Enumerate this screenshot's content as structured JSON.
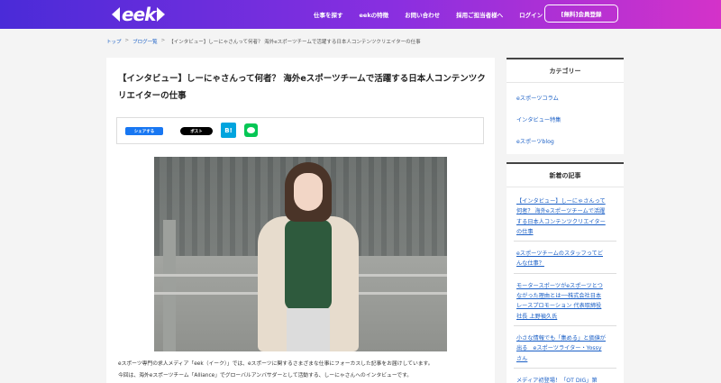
{
  "header": {
    "logo_text": "eek",
    "nav": [
      "仕事を探す",
      "eekの特徴",
      "お問い合わせ",
      "採用ご担当者様へ",
      "ログイン"
    ],
    "register_label": "[無料]会員登録",
    "colors": {
      "gradient_start": "#4a2bd8",
      "gradient_end": "#d432c9"
    }
  },
  "breadcrumb": {
    "items": [
      "トップ",
      "ブログ一覧",
      "【インタビュー】しーにゃさんって何者？ 海外eスポーツチームで活躍する日本人コンテンツクリエイターの仕事"
    ],
    "separator": ">"
  },
  "article": {
    "title": "【インタビュー】しーにゃさんって何者？ 海外eスポーツチームで活躍する日本人コンテンツクリエイターの仕事",
    "share": {
      "facebook_label": "シェアする",
      "x_label": "ポスト",
      "hatena_label": "B!",
      "line_icon": "line-icon"
    },
    "photo_icon": "interview-photo",
    "paragraphs": [
      "eスポーツ専門の求人メディア「eek（イーク）」では、eスポーツに関するさまざまな仕事にフォーカスした記事をお届けしています。",
      "今回は、海外eスポーツチーム「Alliance」でグローバルアンバサダーとして活動する、しーにゃさんへのインタビューです。"
    ]
  },
  "sidebar": {
    "categories": {
      "heading": "カテゴリー",
      "items": [
        "eスポーツコラム",
        "インタビュー特集",
        "eスポーツblog"
      ]
    },
    "news": {
      "heading": "新着の記事",
      "items": [
        [
          "【インタビュー】しーにゃさんって",
          "何者？ 海外eスポーツチームで活躍",
          "する日本人コンテンツクリエイター",
          "の仕事"
        ],
        [
          "eスポーツチームのスタッフってど",
          "んな仕事？"
        ],
        [
          "モータースポーツがeスポーツとつ",
          "ながった理由とは──株式会社日本",
          "レースプロモーション 代表取締役",
          "社長 上野禎久氏"
        ],
        [
          "小さな情報でも「集める」と価値が",
          "出る　eスポーツライター・Yossy",
          "さん"
        ],
        [
          "メディア初登場！「OT DIG」第"
        ]
      ]
    }
  }
}
